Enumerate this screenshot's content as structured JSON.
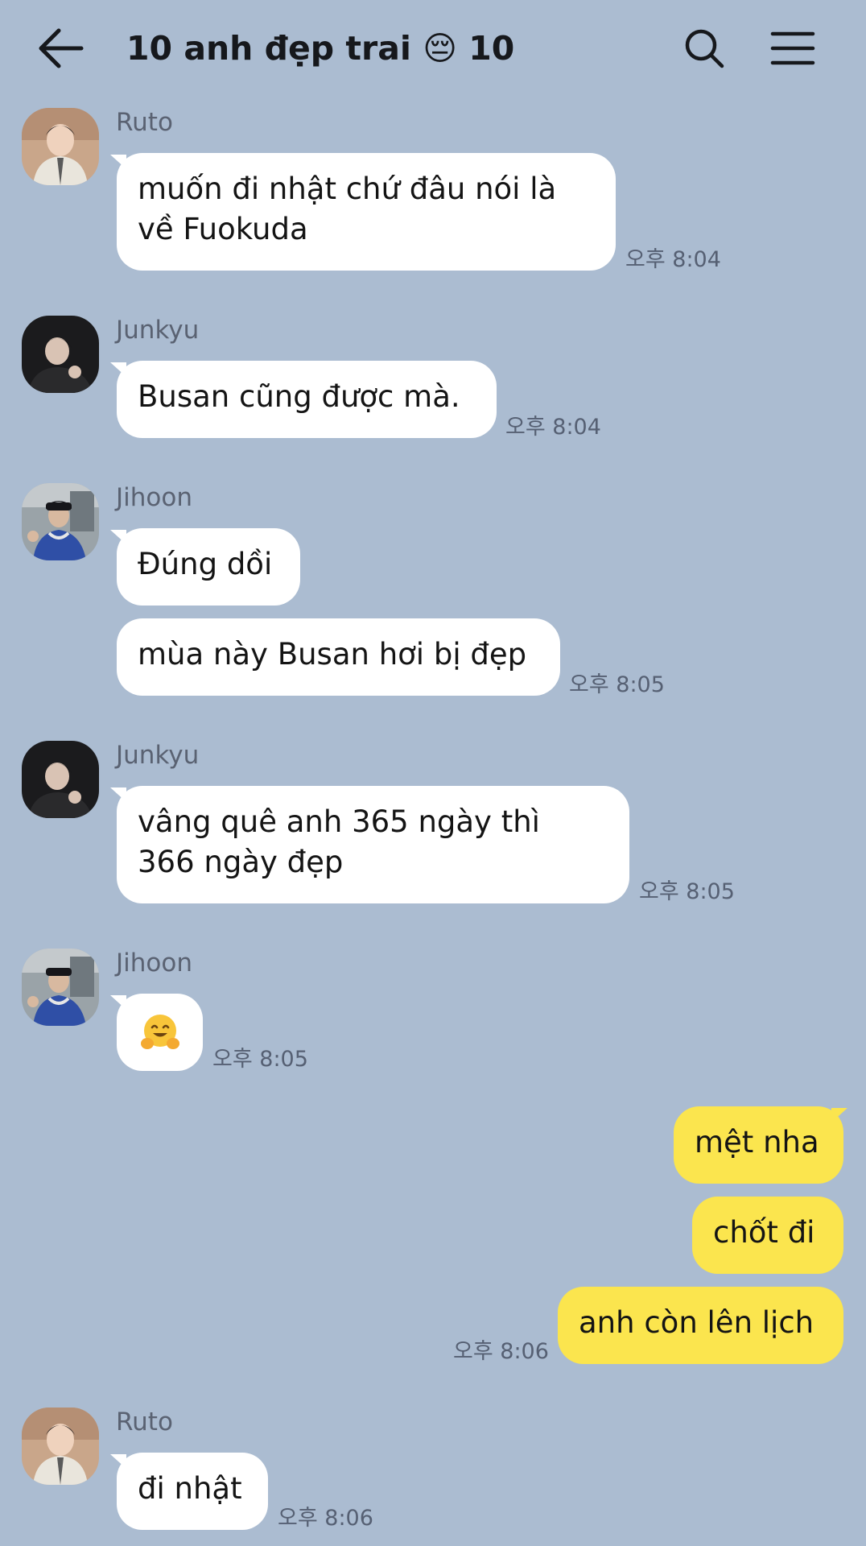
{
  "header": {
    "title": "10 anh đẹp trai 😔 10",
    "back_icon": "arrow-left-icon",
    "search_icon": "search-icon",
    "menu_icon": "hamburger-menu-icon"
  },
  "messages": [
    {
      "sender": "Ruto",
      "lines": [
        "muốn đi nhật chứ đâu nói là",
        "về Fuokuda"
      ],
      "time": "오후 8:04"
    },
    {
      "sender": "Junkyu",
      "lines": [
        "Busan cũng được mà."
      ],
      "time": "오후 8:04"
    },
    {
      "sender": "Jihoon",
      "lines": [
        "Đúng dồi"
      ],
      "time": ""
    },
    {
      "sender": "Jihoon",
      "lines": [
        "mùa này Busan hơi bị đẹp"
      ],
      "time": "오후 8:05"
    },
    {
      "sender": "Junkyu",
      "lines": [
        "vâng quê anh 365 ngày thì",
        "366 ngày đẹp"
      ],
      "time": "오후 8:05"
    },
    {
      "sender": "Jihoon",
      "emoji": "hugging-face-emoji",
      "time": "오후 8:05"
    },
    {
      "sender": "me",
      "lines": [
        "mệt nha"
      ],
      "time": ""
    },
    {
      "sender": "me",
      "lines": [
        "chốt đi"
      ],
      "time": ""
    },
    {
      "sender": "me",
      "lines": [
        "anh còn lên lịch"
      ],
      "time": "오후 8:06"
    },
    {
      "sender": "Ruto",
      "lines": [
        "đi nhật"
      ],
      "time": "오후 8:06"
    }
  ],
  "colors": {
    "background": "#abbcd1",
    "incoming_bubble": "#ffffff",
    "outgoing_bubble": "#fbe54e"
  }
}
